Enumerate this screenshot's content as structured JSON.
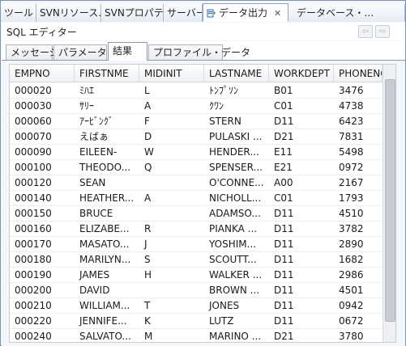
{
  "view_tabs": [
    {
      "label": "ツール"
    },
    {
      "label": "SVNリソース…"
    },
    {
      "label": "SVNプロパティ"
    },
    {
      "label": "サーバー"
    },
    {
      "label": "データ出力"
    },
    {
      "label": "データベース・…"
    }
  ],
  "view_title": "SQL エディター",
  "nav": {
    "back": "⇦",
    "forward": "⇨"
  },
  "inner_tabs": [
    {
      "label": "メッセージ"
    },
    {
      "label": "パラメーター"
    },
    {
      "label": "結果"
    },
    {
      "label": "プロファイル・データ"
    }
  ],
  "columns": [
    "EMPNO",
    "FIRSTNME",
    "MIDINIT",
    "LASTNAME",
    "WORKDEPT",
    "PHONENO"
  ],
  "rows": [
    [
      "000020",
      "ﾐﾊｴ",
      "L",
      "ﾄﾝﾌﾟｿﾝ",
      "B01",
      "3476"
    ],
    [
      "000030",
      "ｻﾘｰ",
      "A",
      "ｸﾜﾝ",
      "C01",
      "4738"
    ],
    [
      "000060",
      "ｱｰﾋﾞﾝｸﾞ",
      "F",
      "STERN",
      "D11",
      "6423"
    ],
    [
      "000070",
      "えばぁ",
      "D",
      "PULASKI ...",
      "D21",
      "7831"
    ],
    [
      "000090",
      "EILEEN-",
      "W",
      "HENDER...",
      "E11",
      "5498"
    ],
    [
      "000100",
      "THEODO...",
      "Q",
      "SPENSER...",
      "E21",
      "0972"
    ],
    [
      "000120",
      "SEAN",
      "",
      "O'CONNE...",
      "A00",
      "2167"
    ],
    [
      "000140",
      "HEATHER...",
      "A",
      "NICHOLL...",
      "C01",
      "1793"
    ],
    [
      "000150",
      "BRUCE",
      "",
      "ADAMSO...",
      "D11",
      "4510"
    ],
    [
      "000160",
      "ELIZABE...",
      "R",
      "PIANKA ...",
      "D11",
      "3782"
    ],
    [
      "000170",
      "MASATO...",
      "J",
      "YOSHIM...",
      "D11",
      "2890"
    ],
    [
      "000180",
      "MARILYN...",
      "S",
      "SCOUTT...",
      "D11",
      "1682"
    ],
    [
      "000190",
      "JAMES",
      "H",
      "WALKER ...",
      "D11",
      "2986"
    ],
    [
      "000200",
      "DAVID",
      "",
      "BROWN ...",
      "D11",
      "4501"
    ],
    [
      "000210",
      "WILLIAM...",
      "T",
      "JONES",
      "D11",
      "0942"
    ],
    [
      "000220",
      "JENNIFE...",
      "K",
      "LUTZ",
      "D11",
      "0672"
    ],
    [
      "000240",
      "SALVATO...",
      "M",
      "MARINO ...",
      "D21",
      "3780"
    ]
  ]
}
